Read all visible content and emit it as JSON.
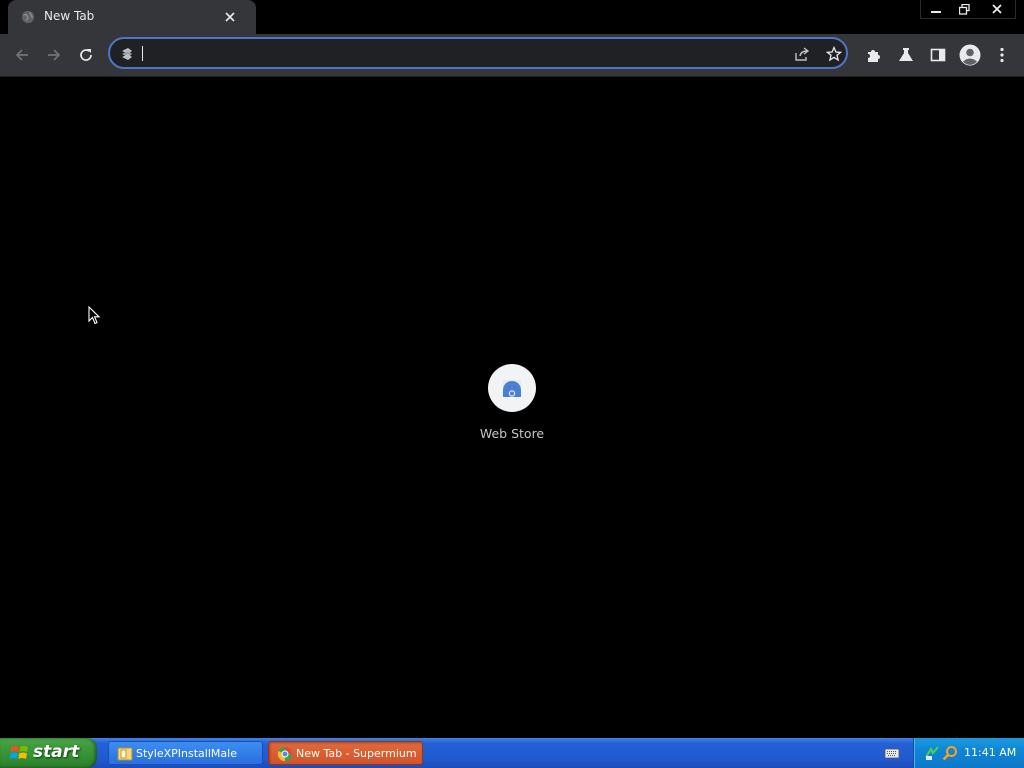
{
  "browser": {
    "tab": {
      "title": "New Tab",
      "favicon": "globe-icon"
    },
    "window_controls": [
      "minimize",
      "restore",
      "close"
    ],
    "toolbar": {
      "back": "back-arrow-icon",
      "forward": "forward-arrow-icon",
      "reload": "reload-icon",
      "omnibox": {
        "value": "",
        "placeholder": ""
      },
      "right_icons": [
        "share-icon",
        "star-icon",
        "extensions-icon",
        "labs-flask-icon",
        "side-panel-icon",
        "profile-avatar-icon",
        "menu-dots-icon"
      ]
    },
    "accent_color": "#4f76c6"
  },
  "ntp": {
    "shortcuts": [
      {
        "title": "Web Store",
        "icon": "web-store-icon"
      }
    ]
  },
  "taskbar": {
    "start_label": "start",
    "tasks": [
      {
        "label": "StyleXPInstallMale",
        "active": false,
        "icon": "folder-icon"
      },
      {
        "label": "New Tab - Supermium",
        "active": true,
        "icon": "supermium-icon"
      }
    ],
    "clock": "11:41 AM"
  }
}
